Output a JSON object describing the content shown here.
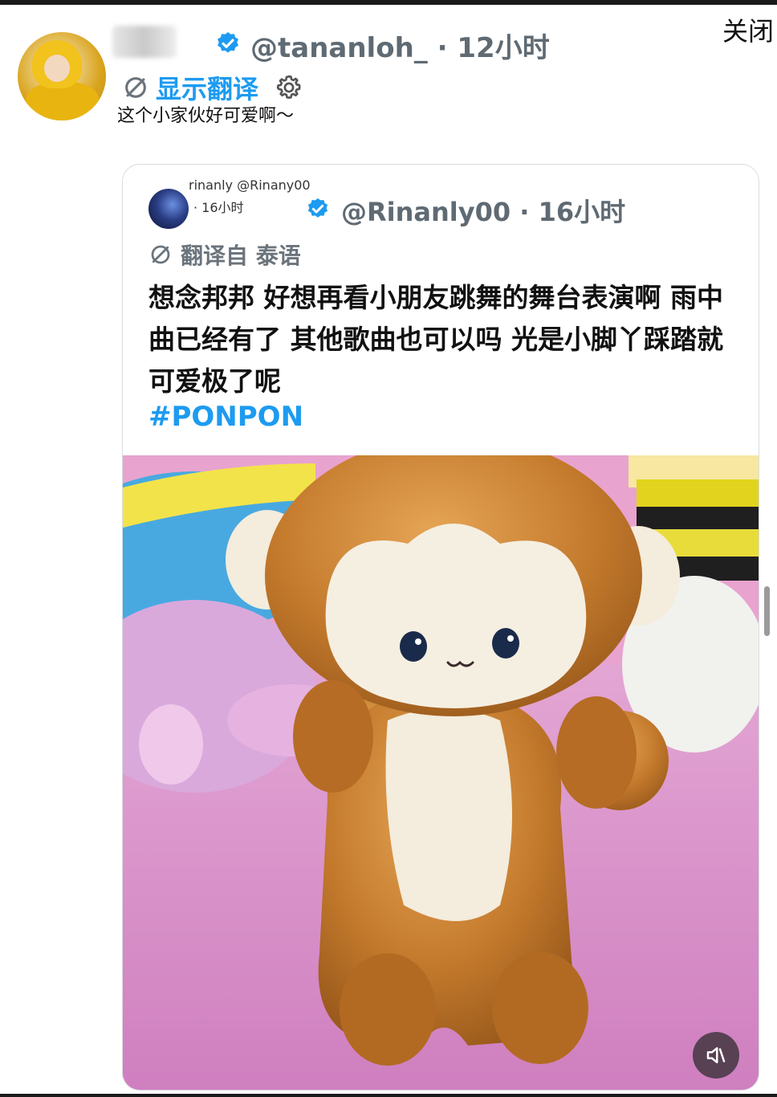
{
  "close_label": "关闭",
  "reply": {
    "handle": "@tananloh_",
    "separator": " · ",
    "time": "12小时",
    "show_translation": "显示翻译",
    "text": "这个小家伙好可爱啊～"
  },
  "quote": {
    "small_name": "rinanly @Rinany00",
    "small_time": "· 16小时",
    "handle": "@Rinanly00",
    "separator": " · ",
    "time": "16小时",
    "translated_from": "翻译自 泰语",
    "body": "想念邦邦 好想再看小朋友跳舞的舞台表演啊 雨中曲已经有了 其他歌曲也可以吗 光是小脚丫踩踏就可爱极了呢",
    "hashtag": "#PONPON"
  },
  "colors": {
    "link_blue": "#1d9bf0",
    "handle_gray": "#5f6a73",
    "verified_blue": "#1d9bf0"
  }
}
